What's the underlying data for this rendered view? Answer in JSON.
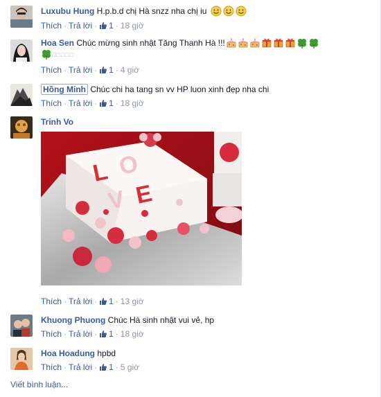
{
  "comments": [
    {
      "author": "Luxubu Hung",
      "text": "H.p.b.d chị Hà snzz nha chị iu",
      "emoji_icons": [
        "smile-icon",
        "smile-icon",
        "smile-icon"
      ],
      "like_label": "Thích",
      "reply_label": "Trả lời",
      "like_count": "1",
      "time": "18 giờ"
    },
    {
      "author": "Hoa Sen",
      "text": "Chúc mừng sinh nhật Tăng Thanh Hà !!!",
      "sticker_icons": [
        "cake-icon",
        "cake-icon",
        "cake-icon",
        "gift-icon",
        "gift-icon",
        "gift-icon",
        "clover-icon",
        "clover-icon",
        "clover-icon"
      ],
      "trailing_text": "□□□□□",
      "like_label": "Thích",
      "reply_label": "Trả lời",
      "like_count": "1",
      "time": "4 giờ"
    },
    {
      "author": "Hồng Minh",
      "text": "Chúc chi ha tang sn vv HP luon xinh đẹp nha chi",
      "like_label": "Thích",
      "reply_label": "Trả lời",
      "like_count": "1",
      "time": "18 giờ"
    },
    {
      "author": "Trinh Vo",
      "text": "",
      "photo": "love-cake-photo",
      "like_label": "Thích",
      "reply_label": "Trả lời",
      "like_count": "1",
      "time": "13 giờ"
    },
    {
      "author": "Khuong Phuong",
      "text": "Chúc Hà sinh nhật vui vẻ, hp",
      "like_label": "Thích",
      "reply_label": "Trả lời",
      "like_count": "1",
      "time": "18 giờ"
    },
    {
      "author": "Hoa Hoadung",
      "text": "hpbd",
      "like_label": "Thích",
      "reply_label": "Trả lời",
      "like_count": "1",
      "time": "5 giờ"
    }
  ],
  "photo_text": {
    "letter_l": "L",
    "letter_o": "O",
    "letter_v": "V",
    "letter_e": "E"
  },
  "write_comment_label": "Viết bình luận...",
  "colors": {
    "link": "#3b5998",
    "meta": "#9197a3",
    "text": "#141823"
  }
}
